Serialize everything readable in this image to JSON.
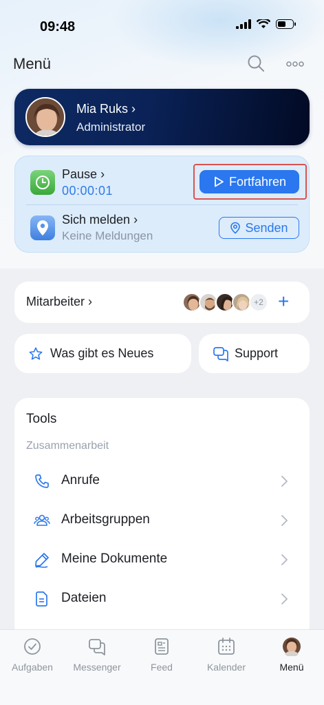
{
  "status_bar": {
    "time": "09:48"
  },
  "header": {
    "title": "Menü"
  },
  "profile": {
    "name": "Mia Ruks",
    "role": "Administrator"
  },
  "time_tracking": {
    "pause_label": "Pause",
    "pause_time": "00:00:01",
    "continue_label": "Fortfahren",
    "report_label": "Sich melden",
    "report_sub": "Keine Meldungen",
    "send_label": "Senden"
  },
  "employees": {
    "label": "Mitarbeiter",
    "more_count": "+2"
  },
  "quick": {
    "news_label": "Was gibt es Neues",
    "support_label": "Support"
  },
  "tools": {
    "title": "Tools",
    "section": "Zusammenarbeit",
    "items": [
      {
        "label": "Anrufe",
        "icon": "phone-icon"
      },
      {
        "label": "Arbeitsgruppen",
        "icon": "group-icon"
      },
      {
        "label": "Meine Dokumente",
        "icon": "pen-icon"
      },
      {
        "label": "Dateien",
        "icon": "file-icon"
      }
    ]
  },
  "tabbar": {
    "items": [
      {
        "label": "Aufgaben",
        "icon": "check-circle-icon"
      },
      {
        "label": "Messenger",
        "icon": "chat-icon"
      },
      {
        "label": "Feed",
        "icon": "feed-icon"
      },
      {
        "label": "Kalender",
        "icon": "calendar-icon"
      },
      {
        "label": "Menü",
        "icon": "avatar-icon"
      }
    ],
    "active": "Menü"
  },
  "colors": {
    "accent": "#2a77ef",
    "profile_bg": "#0a2257",
    "highlight": "#d9534f"
  }
}
